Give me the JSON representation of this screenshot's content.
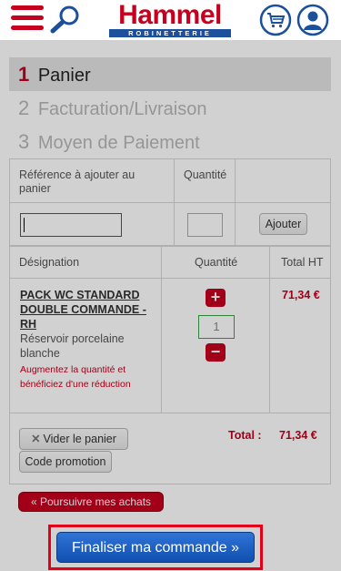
{
  "header": {
    "logo_main": "Hammel",
    "logo_sub": "ROBINETTERIE"
  },
  "icons": {
    "menu": "menu-icon",
    "search": "search-icon",
    "cart": "cart-icon",
    "user": "user-icon"
  },
  "colors": {
    "brand_red": "#c6001e",
    "brand_blue": "#1c4f9c",
    "finalize_blue": "#0f4fb0",
    "highlight_border": "#e2001a"
  },
  "steps": [
    {
      "num": "1",
      "label": "Panier",
      "active": true
    },
    {
      "num": "2",
      "label": "Facturation/Livraison",
      "active": false
    },
    {
      "num": "3",
      "label": "Moyen de Paiement",
      "active": false
    }
  ],
  "add_form": {
    "ref_header": "Référence à ajouter au panier",
    "qty_header": "Quantité",
    "ref_value": "",
    "qty_value": "",
    "add_button": "Ajouter"
  },
  "cart_table": {
    "headers": {
      "designation": "Désignation",
      "quantity": "Quantité",
      "total": "Total HT"
    },
    "items": [
      {
        "name": "PACK WC STANDARD DOUBLE COMMANDE - RH",
        "description": "Réservoir porcelaine blanche",
        "promo": "Augmentez la quantité et bénéficiez d'une réduction",
        "quantity": "1",
        "total": "71,34 €"
      }
    ]
  },
  "actions": {
    "empty_cart": "Vider le panier",
    "promo_code": "Code promotion",
    "total_label": "Total :",
    "total_value": "71,34 €",
    "continue_shopping": "« Poursuivre mes achats",
    "finalize": "Finaliser ma commande »"
  }
}
